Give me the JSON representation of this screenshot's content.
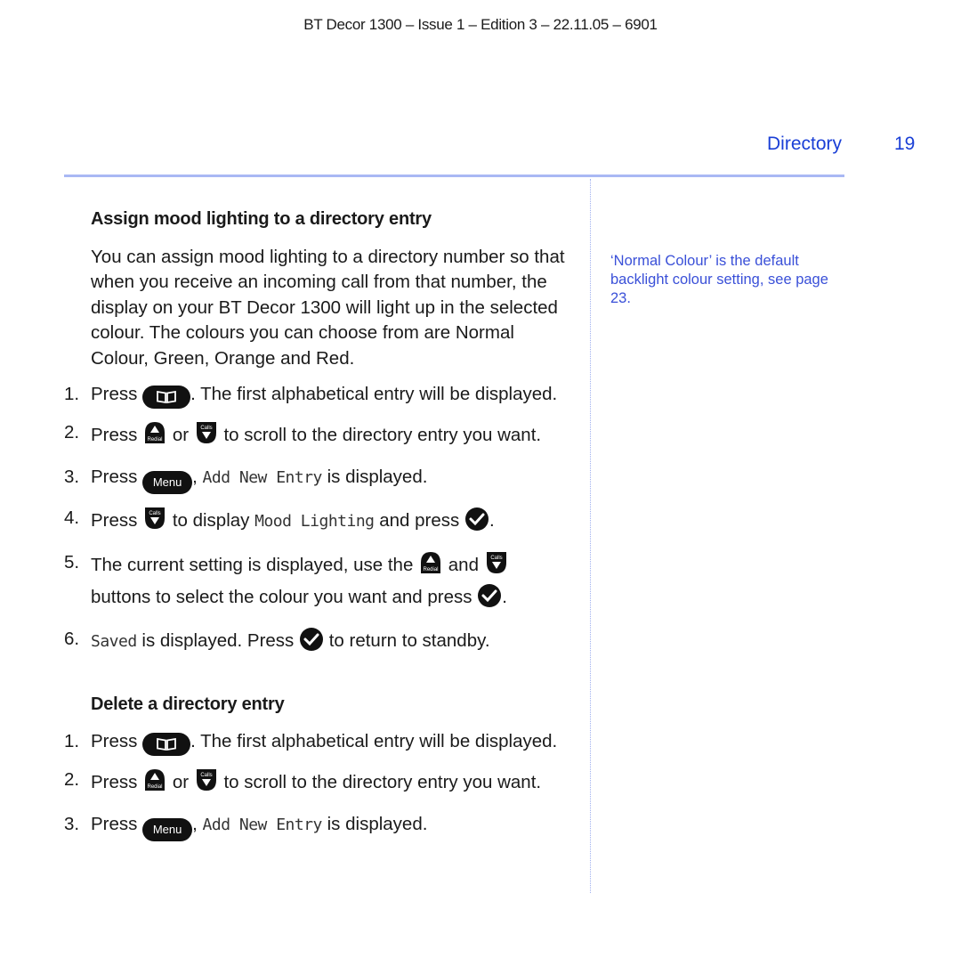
{
  "header": {
    "doc_info": "BT Decor 1300 – Issue 1 – Edition 3 – 22.11.05 – 6901"
  },
  "section": {
    "title": "Directory",
    "page_number": "19"
  },
  "sidebar_note": "‘Normal Colour’ is the default backlight colour setting, see page 23.",
  "colors": {
    "accent": "#1a3fd6",
    "rule": "#a9b8f4",
    "note": "#3a50d8"
  },
  "assign": {
    "heading": "Assign mood lighting to a directory entry",
    "intro": "You can assign mood lighting to a directory number so that when you receive an incoming call from that number, the display on your BT Decor 1300 will light up in the selected colour. The colours you can choose from are Normal Colour, Green, Orange and Red.",
    "steps": [
      {
        "num": "1.",
        "a": "Press",
        "b": ". The first alphabetical entry will be displayed."
      },
      {
        "num": "2.",
        "a": "Press",
        "or": "or",
        "b": "to scroll to the directory entry you want."
      },
      {
        "num": "3.",
        "a": "Press",
        "key": "Menu",
        "comma": ",",
        "lcd": "Add New Entry",
        "b": "is displayed."
      },
      {
        "num": "4.",
        "a": "Press",
        "b": "to display",
        "lcd": "Mood Lighting",
        "c": "and press",
        "d": "."
      },
      {
        "num": "5.",
        "a": "The current setting is displayed, use the",
        "and": "and",
        "b": "buttons to select the colour you want and press",
        "d": "."
      },
      {
        "num": "6.",
        "lcd": "Saved",
        "a": "is displayed. Press",
        "b": "to return to standby."
      }
    ]
  },
  "delete": {
    "heading": "Delete a directory entry",
    "steps": [
      {
        "num": "1.",
        "a": "Press",
        "b": ". The first alphabetical entry will be displayed."
      },
      {
        "num": "2.",
        "a": "Press",
        "or": "or",
        "b": "to scroll to the directory entry you want."
      },
      {
        "num": "3.",
        "a": "Press",
        "key": "Menu",
        "comma": ",",
        "lcd": "Add New Entry",
        "b": "is displayed."
      }
    ]
  },
  "keys": {
    "redial_label": "Redial",
    "calls_label": "Calls"
  }
}
